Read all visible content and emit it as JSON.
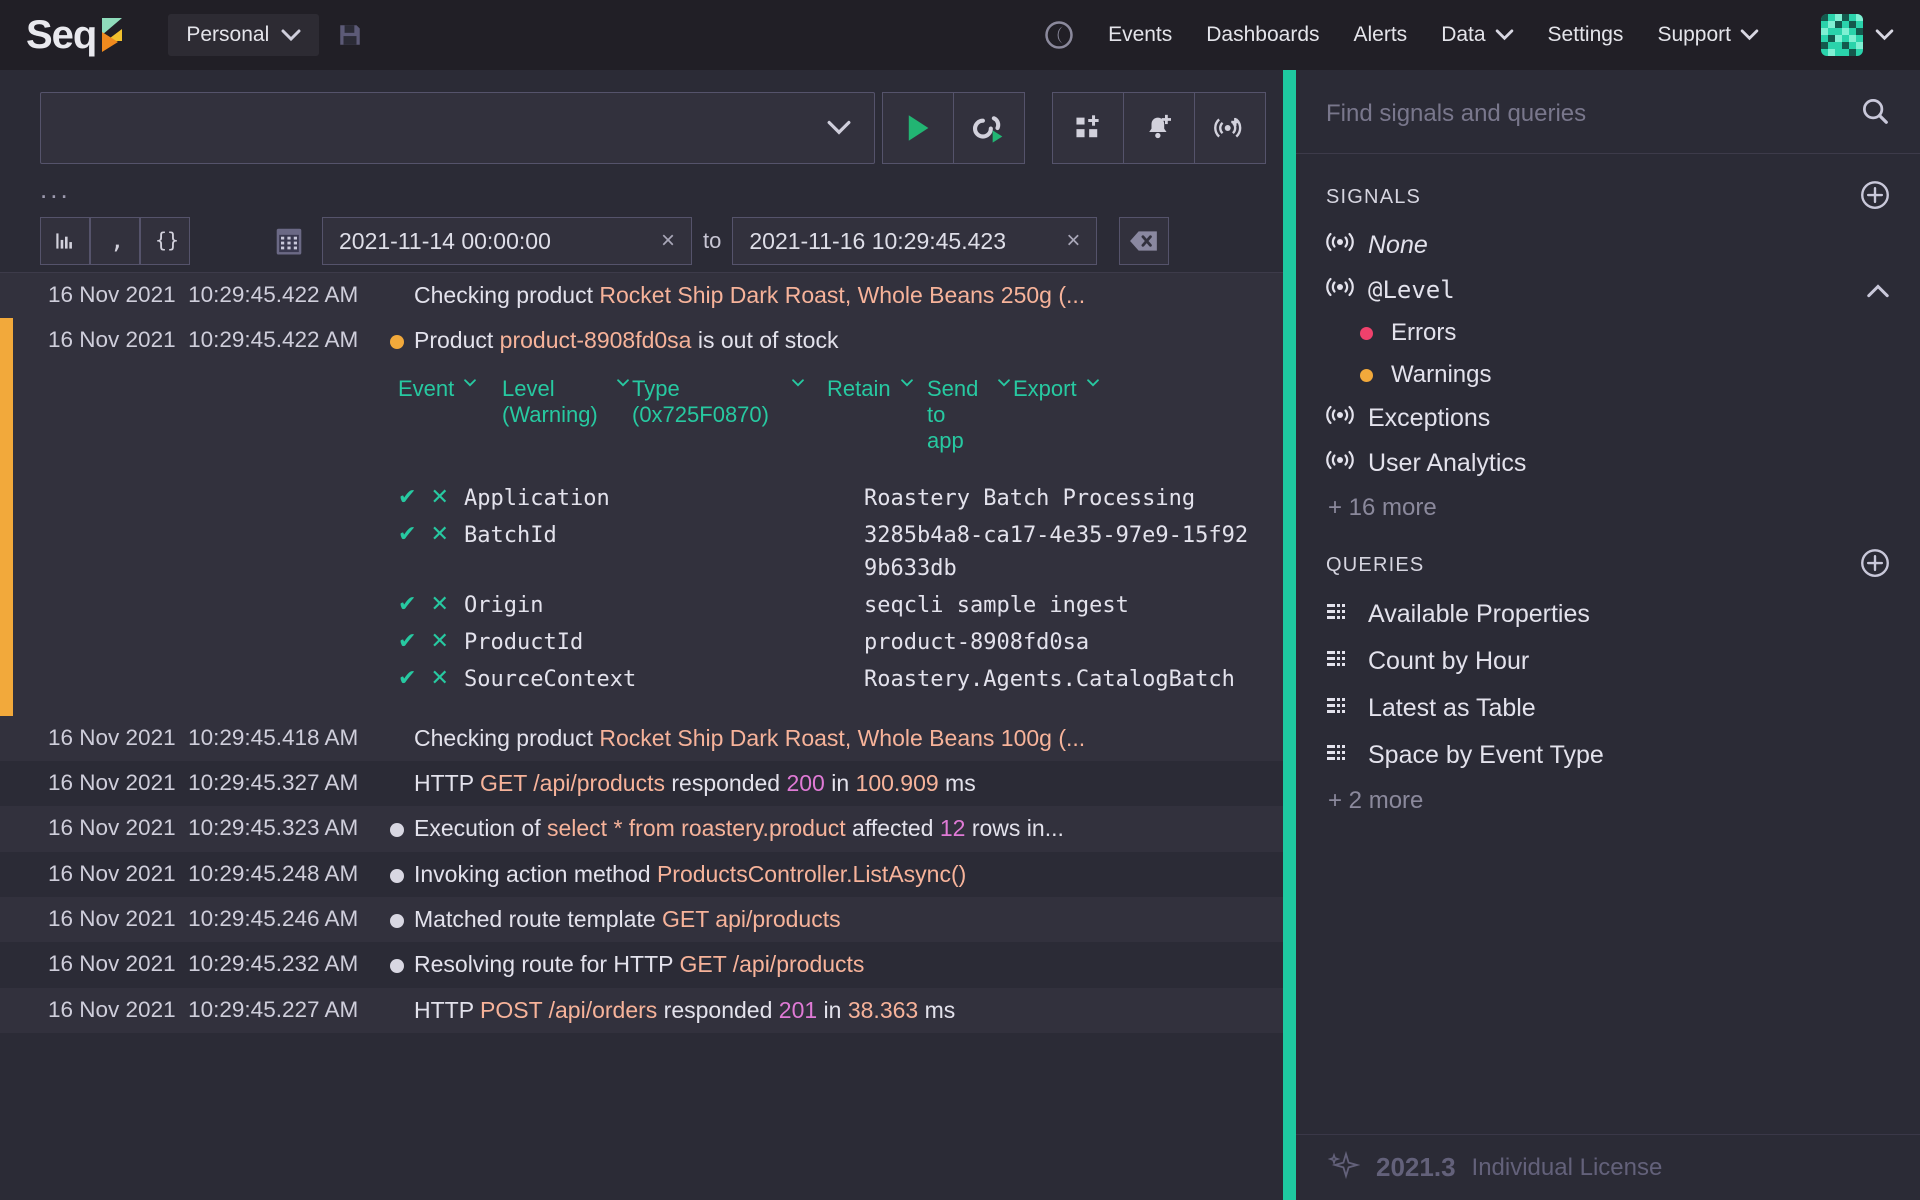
{
  "topnav": {
    "brand": "Seq",
    "brand_icon": "seq-logo-icon",
    "workspace": "Personal",
    "workspace_chevron": "chevron-down-icon",
    "save_icon": "save-disk-icon",
    "theme_icon": "moon-icon",
    "links": [
      {
        "label": "Events",
        "name": "nav-events",
        "chevron": false
      },
      {
        "label": "Dashboards",
        "name": "nav-dashboards",
        "chevron": false
      },
      {
        "label": "Alerts",
        "name": "nav-alerts",
        "chevron": false
      },
      {
        "label": "Data",
        "name": "nav-data",
        "chevron": true
      },
      {
        "label": "Settings",
        "name": "nav-settings",
        "chevron": false
      },
      {
        "label": "Support",
        "name": "nav-support",
        "chevron": true
      }
    ],
    "avatar_icon": "user-avatar-identicon",
    "avatar_chevron": "chevron-down-icon"
  },
  "querybar": {
    "query_value": "",
    "query_placeholder": "",
    "dropdown_icon": "chevron-down-icon",
    "buttons": [
      {
        "name": "run-query-button",
        "icon": "play-icon"
      },
      {
        "name": "run-continuously-button",
        "icon": "replay-play-icon"
      },
      {
        "name": "add-to-dashboard-button",
        "icon": "dashboard-plus-icon"
      },
      {
        "name": "create-alert-button",
        "icon": "bell-plus-icon"
      },
      {
        "name": "create-signal-button",
        "icon": "signal-plus-icon"
      }
    ],
    "overflow": "..."
  },
  "filterrow": {
    "view_buttons": [
      {
        "name": "chart-view-button",
        "icon": "bar-chart-icon"
      },
      {
        "name": "raw-view-button",
        "icon": "comma-icon"
      },
      {
        "name": "json-view-button",
        "icon": "braces-icon"
      }
    ],
    "calendar_icon": "calendar-icon",
    "from_value": "2021-11-14 00:00:00",
    "to_label": "to",
    "to_value": "2021-11-16 10:29:45.423",
    "clear_icon": "x-icon",
    "clear_range_icon": "backspace-icon"
  },
  "events": [
    {
      "date": "16 Nov 2021",
      "time": "10:29:45.422 AM",
      "level_dot": null,
      "alt": true,
      "segments": [
        {
          "t": "Checking product ",
          "c": "plain"
        },
        {
          "t": "Rocket Ship Dark Roast, Whole Beans 250g (...",
          "c": "prop"
        }
      ]
    },
    {
      "date": "16 Nov 2021",
      "time": "10:29:45.422 AM",
      "level_dot": "#f2a93b",
      "expanded": true,
      "segments": [
        {
          "t": "Product ",
          "c": "plain"
        },
        {
          "t": "product-8908fd0sa",
          "c": "prop"
        },
        {
          "t": " is out of stock",
          "c": "plain"
        }
      ]
    },
    {
      "date": "16 Nov 2021",
      "time": "10:29:45.418 AM",
      "level_dot": null,
      "alt": true,
      "segments": [
        {
          "t": "Checking product ",
          "c": "plain"
        },
        {
          "t": "Rocket Ship Dark Roast, Whole Beans 100g (...",
          "c": "prop"
        }
      ]
    },
    {
      "date": "16 Nov 2021",
      "time": "10:29:45.327 AM",
      "level_dot": null,
      "segments": [
        {
          "t": "HTTP ",
          "c": "plain"
        },
        {
          "t": "GET /api/products",
          "c": "prop"
        },
        {
          "t": " responded ",
          "c": "plain"
        },
        {
          "t": "200",
          "c": "num"
        },
        {
          "t": " in ",
          "c": "plain"
        },
        {
          "t": "100.909",
          "c": "prop"
        },
        {
          "t": " ms",
          "c": "plain"
        }
      ]
    },
    {
      "date": "16 Nov 2021",
      "time": "10:29:45.323 AM",
      "level_dot": "#d8d7e2",
      "segments": [
        {
          "t": "Execution of ",
          "c": "plain"
        },
        {
          "t": "select * from roastery.product",
          "c": "prop"
        },
        {
          "t": " affected ",
          "c": "plain"
        },
        {
          "t": "12",
          "c": "num"
        },
        {
          "t": " rows in...",
          "c": "plain"
        }
      ]
    },
    {
      "date": "16 Nov 2021",
      "time": "10:29:45.248 AM",
      "level_dot": "#d8d7e2",
      "segments": [
        {
          "t": "Invoking action method ",
          "c": "plain"
        },
        {
          "t": "ProductsController.ListAsync()",
          "c": "prop"
        }
      ]
    },
    {
      "date": "16 Nov 2021",
      "time": "10:29:45.246 AM",
      "level_dot": "#d8d7e2",
      "segments": [
        {
          "t": "Matched route template ",
          "c": "plain"
        },
        {
          "t": "GET api/products",
          "c": "prop"
        }
      ]
    },
    {
      "date": "16 Nov 2021",
      "time": "10:29:45.232 AM",
      "level_dot": "#d8d7e2",
      "segments": [
        {
          "t": "Resolving route for HTTP ",
          "c": "plain"
        },
        {
          "t": "GET /api/products",
          "c": "prop"
        }
      ]
    },
    {
      "date": "16 Nov 2021",
      "time": "10:29:45.227 AM",
      "level_dot": null,
      "segments": [
        {
          "t": "HTTP ",
          "c": "plain"
        },
        {
          "t": "POST /api/orders",
          "c": "prop"
        },
        {
          "t": " responded ",
          "c": "plain"
        },
        {
          "t": "201",
          "c": "num"
        },
        {
          "t": " in ",
          "c": "plain"
        },
        {
          "t": "38.363",
          "c": "prop"
        },
        {
          "t": " ms",
          "c": "plain"
        }
      ]
    }
  ],
  "detail": {
    "menu": [
      {
        "label": "Event",
        "name": "detail-menu-event",
        "chevron": true,
        "cls": "dm-event"
      },
      {
        "label": "Level (Warning)",
        "name": "detail-menu-level",
        "chevron": true,
        "cls": "dm-level"
      },
      {
        "label": "Type (0x725F0870)",
        "name": "detail-menu-type",
        "chevron": true,
        "cls": "dm-type"
      },
      {
        "label": "Retain",
        "name": "detail-menu-retain",
        "chevron": true,
        "cls": "dm-retain"
      },
      {
        "label": "Send to app",
        "name": "detail-menu-send-to-app",
        "chevron": true,
        "cls": "dm-send"
      },
      {
        "label": "Export",
        "name": "detail-menu-export",
        "chevron": true,
        "cls": "dm-export"
      }
    ],
    "include_icon": "check-icon",
    "exclude_icon": "x-icon",
    "properties": [
      {
        "name": "Application",
        "value": "Roastery Batch Processing"
      },
      {
        "name": "BatchId",
        "value": "3285b4a8-ca17-4e35-97e9-15f929b633db"
      },
      {
        "name": "Origin",
        "value": "seqcli sample ingest"
      },
      {
        "name": "ProductId",
        "value": "product-8908fd0sa"
      },
      {
        "name": "SourceContext",
        "value": "Roastery.Agents.CatalogBatch"
      }
    ]
  },
  "sidebar": {
    "search_placeholder": "Find signals and queries",
    "search_value": "",
    "search_icon": "search-icon",
    "signals_title": "SIGNALS",
    "signals_add_icon": "plus-circle-icon",
    "signals": [
      {
        "label": "None",
        "icon": "signal-icon",
        "style": "italic",
        "name": "signal-none"
      },
      {
        "label": "@Level",
        "icon": "signal-icon",
        "style": "mono",
        "expanded": true,
        "name": "signal-level"
      },
      {
        "label": "Exceptions",
        "icon": "signal-icon",
        "style": "plain",
        "name": "signal-exceptions"
      },
      {
        "label": "User Analytics",
        "icon": "signal-icon",
        "style": "plain",
        "name": "signal-user-analytics"
      }
    ],
    "level_children": [
      {
        "label": "Errors",
        "color": "#f0416c",
        "name": "signal-level-errors"
      },
      {
        "label": "Warnings",
        "color": "#f2a93b",
        "name": "signal-level-warnings"
      }
    ],
    "signals_more": "+ 16 more",
    "queries_title": "QUERIES",
    "queries_add_icon": "plus-circle-icon",
    "queries": [
      {
        "label": "Available Properties",
        "icon": "table-icon",
        "name": "query-available-properties"
      },
      {
        "label": "Count by Hour",
        "icon": "table-icon",
        "name": "query-count-by-hour"
      },
      {
        "label": "Latest as Table",
        "icon": "table-icon",
        "name": "query-latest-as-table"
      },
      {
        "label": "Space by Event Type",
        "icon": "table-icon",
        "name": "query-space-by-event-type"
      }
    ],
    "queries_more": "+ 2 more",
    "license_icon": "sparkle-icon",
    "license_version": "2021.3",
    "license_text": "Individual License"
  },
  "colors": {
    "accent": "#1ec9a0",
    "warning": "#f2a93b",
    "error": "#f0416c",
    "property": "#f7b39a",
    "number": "#e07ad6"
  }
}
